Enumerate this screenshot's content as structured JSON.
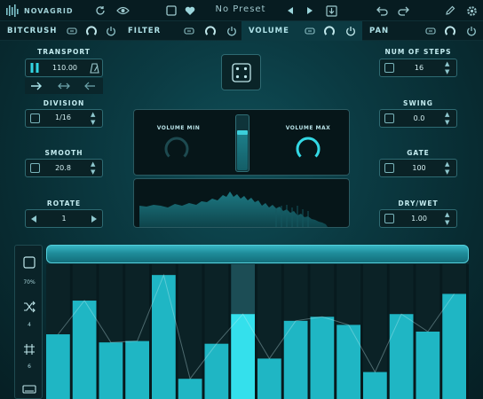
{
  "header": {
    "brand": "NOVAGRID",
    "preset": "No Preset",
    "icons": [
      "brand-logo-icon",
      "refresh-icon",
      "eye-icon",
      "square-icon",
      "heart-icon",
      "prev-icon",
      "next-icon",
      "save-icon",
      "undo-icon",
      "redo-icon",
      "pencil-icon",
      "settings-icon"
    ]
  },
  "tabs": [
    {
      "label": "BITCRUSH",
      "active": false
    },
    {
      "label": "FILTER",
      "active": false
    },
    {
      "label": "VOLUME",
      "active": true
    },
    {
      "label": "PAN",
      "active": false
    }
  ],
  "left": {
    "transport_label": "TRANSPORT",
    "bpm": "110.00",
    "division_label": "DIVISION",
    "division": "1/16",
    "smooth_label": "SMOOTH",
    "smooth": "20.8",
    "rotate_label": "ROTATE",
    "rotate": "1"
  },
  "right": {
    "steps_label": "NUM OF STEPS",
    "steps": "16",
    "swing_label": "SWING",
    "swing": "0.0",
    "gate_label": "GATE",
    "gate": "100",
    "drywet_label": "DRY/WET",
    "drywet": "1.00"
  },
  "center": {
    "vol_min_label": "VOLUME MIN",
    "vol_max_label": "VOLUME MAX",
    "vol_min_level": 0.0,
    "vol_max_level": 1.0
  },
  "sequencer": {
    "side_pct": "70%",
    "side_a": "4",
    "side_b": "6",
    "steps": [
      0.48,
      0.73,
      0.42,
      0.43,
      0.92,
      0.15,
      0.41,
      0.63,
      0.3,
      0.58,
      0.61,
      0.55,
      0.2,
      0.63,
      0.5,
      0.78
    ],
    "active_step": 7
  },
  "colors": {
    "accent": "#22c9d6",
    "bar": "#1fb6c4",
    "bar_active": "#34e0ec",
    "bg": "#082b31"
  }
}
